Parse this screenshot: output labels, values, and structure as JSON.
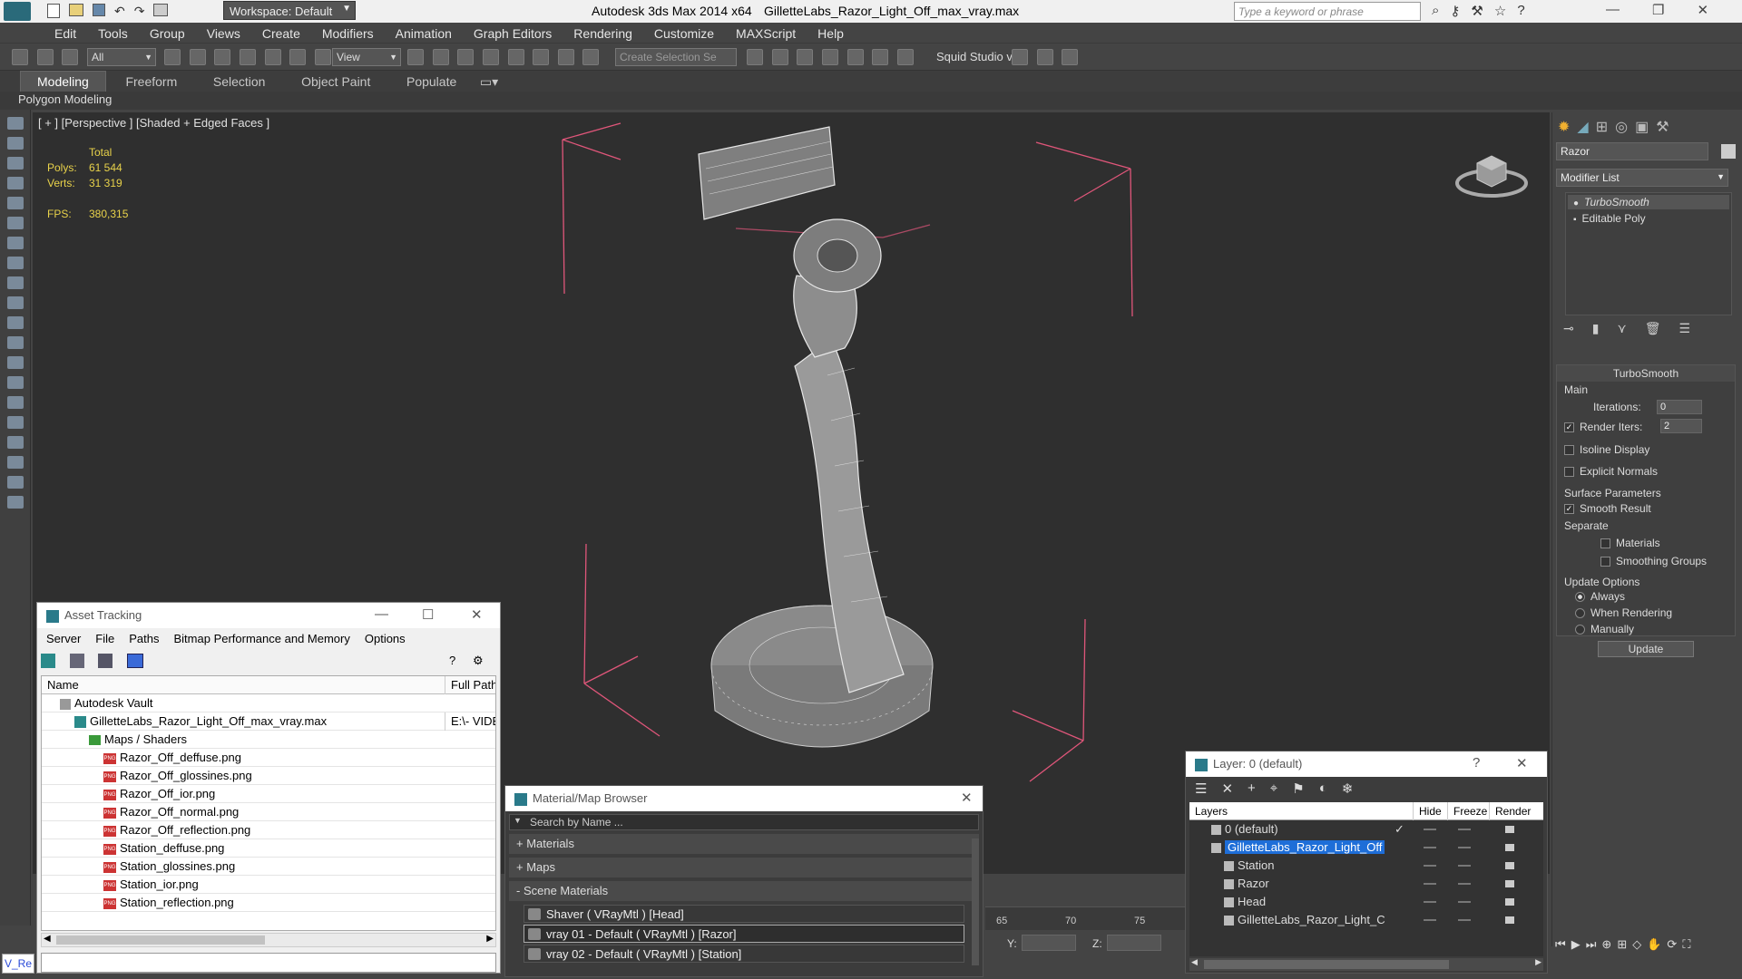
{
  "titlebar": {
    "workspace": "Workspace: Default",
    "app_title": "Autodesk 3ds Max  2014 x64",
    "file_title": "GilletteLabs_Razor_Light_Off_max_vray.max",
    "search_placeholder": "Type a keyword or phrase"
  },
  "menu": [
    "Edit",
    "Tools",
    "Group",
    "Views",
    "Create",
    "Modifiers",
    "Animation",
    "Graph Editors",
    "Rendering",
    "Customize",
    "MAXScript",
    "Help"
  ],
  "toolbar": {
    "filter_value": "All",
    "refcoord_value": "View",
    "selection_set_placeholder": "Create Selection Se",
    "squid_label": "Squid Studio v"
  },
  "ribbon": {
    "tabs": [
      "Modeling",
      "Freeform",
      "Selection",
      "Object Paint",
      "Populate"
    ],
    "sub_label": "Polygon Modeling"
  },
  "viewport": {
    "label": "[ + ] [Perspective ] [Shaded + Edged Faces ]",
    "stats": {
      "total_label": "Total",
      "polys_label": "Polys:",
      "polys_value": "61 544",
      "verts_label": "Verts:",
      "verts_value": "31 319",
      "fps_label": "FPS:",
      "fps_value": "380,315"
    }
  },
  "command_panel": {
    "object_name": "Razor",
    "modifier_list": "Modifier List",
    "stack": [
      "TurboSmooth",
      "Editable Poly"
    ],
    "rollout_title": "TurboSmooth",
    "main_label": "Main",
    "iterations_label": "Iterations:",
    "iterations_value": "0",
    "render_iters_label": "Render Iters:",
    "render_iters_value": "2",
    "isoline_label": "Isoline Display",
    "explicit_normals_label": "Explicit Normals",
    "surface_params_label": "Surface Parameters",
    "smooth_result_label": "Smooth Result",
    "separate_label": "Separate",
    "materials_label": "Materials",
    "smoothing_groups_label": "Smoothing Groups",
    "update_options_label": "Update Options",
    "always_label": "Always",
    "when_rendering_label": "When Rendering",
    "manually_label": "Manually",
    "update_button": "Update"
  },
  "asset_tracking": {
    "title": "Asset Tracking",
    "menu": [
      "Server",
      "File",
      "Paths",
      "Bitmap Performance and Memory",
      "Options"
    ],
    "col_name": "Name",
    "col_path": "Full Path",
    "rows": [
      {
        "name": "Autodesk Vault",
        "path": "",
        "indent": 1,
        "kind": "vault"
      },
      {
        "name": "GilletteLabs_Razor_Light_Off_max_vray.max",
        "path": "E:\\- VIDE",
        "indent": 2,
        "kind": "max"
      },
      {
        "name": "Maps / Shaders",
        "path": "",
        "indent": 3,
        "kind": "folder"
      },
      {
        "name": "Razor_Off_deffuse.png",
        "path": "",
        "indent": 4,
        "kind": "png"
      },
      {
        "name": "Razor_Off_glossines.png",
        "path": "",
        "indent": 4,
        "kind": "png"
      },
      {
        "name": "Razor_Off_ior.png",
        "path": "",
        "indent": 4,
        "kind": "png"
      },
      {
        "name": "Razor_Off_normal.png",
        "path": "",
        "indent": 4,
        "kind": "png"
      },
      {
        "name": "Razor_Off_reflection.png",
        "path": "",
        "indent": 4,
        "kind": "png"
      },
      {
        "name": "Station_deffuse.png",
        "path": "",
        "indent": 4,
        "kind": "png"
      },
      {
        "name": "Station_glossines.png",
        "path": "",
        "indent": 4,
        "kind": "png"
      },
      {
        "name": "Station_ior.png",
        "path": "",
        "indent": 4,
        "kind": "png"
      },
      {
        "name": "Station_reflection.png",
        "path": "",
        "indent": 4,
        "kind": "png"
      }
    ]
  },
  "material_browser": {
    "title": "Material/Map Browser",
    "search_placeholder": "Search by Name ...",
    "sections": [
      "+ Materials",
      "+ Maps",
      "- Scene Materials"
    ],
    "items": [
      "Shaver  ( VRayMtl )  [Head]",
      "vray 01 - Default  ( VRayMtl )  [Razor]",
      "vray 02 - Default  ( VRayMtl )  [Station]"
    ]
  },
  "layer_window": {
    "title": "Layer: 0 (default)",
    "col_layers": "Layers",
    "col_hide": "Hide",
    "col_freeze": "Freeze",
    "col_render": "Render",
    "rows": [
      {
        "name": "0 (default)",
        "indent": 1,
        "selected": false
      },
      {
        "name": "GilletteLabs_Razor_Light_Off",
        "indent": 1,
        "selected": true
      },
      {
        "name": "Station",
        "indent": 2,
        "selected": false
      },
      {
        "name": "Razor",
        "indent": 2,
        "selected": false
      },
      {
        "name": "Head",
        "indent": 2,
        "selected": false
      },
      {
        "name": "GilletteLabs_Razor_Light_C",
        "indent": 2,
        "selected": false
      }
    ]
  },
  "timeline": {
    "ticks": [
      "65",
      "70",
      "75"
    ],
    "y_label": "Y:",
    "z_label": "Z:"
  },
  "status": {
    "script_label": "V_Re"
  },
  "colors": {
    "viewport_bg": "#2f2f2f",
    "stats_yellow": "#e8d24a",
    "gizmo_pink": "#e0567a",
    "selection_blue": "#1e6ed8"
  }
}
